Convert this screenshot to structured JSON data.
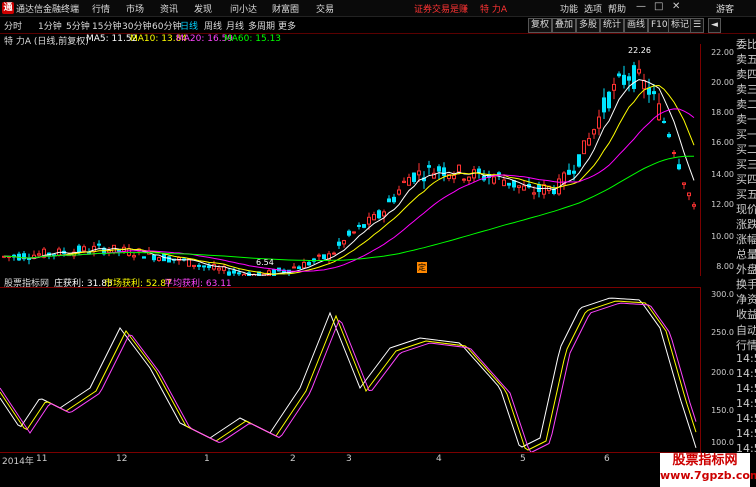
{
  "menubar": {
    "app_title": "通达信金融终端",
    "items": [
      "行情",
      "市场",
      "资讯",
      "发现",
      "问小达",
      "财富圈",
      "交易"
    ],
    "promo": "证券交易是赚",
    "stock": "特 力A",
    "right_items": [
      "功能",
      "选项",
      "帮助"
    ],
    "user": "游客"
  },
  "toolbar": {
    "periods": [
      "分时",
      "1分钟",
      "5分钟",
      "15分钟",
      "30分钟",
      "60分钟",
      "日线",
      "周线",
      "月线",
      "多周期",
      "更多"
    ],
    "selected": "日线",
    "buttons": [
      "复权",
      "叠加",
      "多股",
      "统计",
      "画线",
      "F10",
      "标记"
    ]
  },
  "main": {
    "stock_label": "特 力A (日线,前复权)",
    "ma5": "MA5: 11.52",
    "ma10": "MA10: 13.84",
    "ma20": "MA20: 16.59",
    "ma60": "MA60: 15.13",
    "high_label": "22.26",
    "low_label": "6.54",
    "marker": "定",
    "yticks": [
      "22.00",
      "20.00",
      "18.00",
      "16.00",
      "14.00",
      "12.00",
      "10.00",
      "8.00"
    ]
  },
  "indicator": {
    "name": "股票指标网",
    "v1": "庄获利: 31.83",
    "v2": "市场获利: 52.87",
    "v3": "平均获利: 63.11",
    "yticks": [
      "300.0",
      "250.0",
      "200.0",
      "150.0",
      "100.0"
    ]
  },
  "axis": {
    "labels": [
      "2014年",
      "11",
      "12",
      "1",
      "2",
      "3",
      "4",
      "5",
      "6"
    ]
  },
  "right_panel": {
    "labels": [
      "委比",
      "卖五",
      "卖四",
      "卖三",
      "卖二",
      "卖一",
      "买一",
      "买二",
      "买三",
      "买四",
      "买五",
      "现价",
      "涨跌",
      "涨幅",
      "总量",
      "外盘",
      "换手",
      "净资",
      "收益"
    ],
    "lower": [
      "自动",
      "行情",
      "14:5",
      "14:5",
      "14:5",
      "14:5",
      "14:5",
      "14:5",
      "14:5",
      "14:5",
      "14:5"
    ]
  },
  "watermark": {
    "line1": "股票指标网",
    "line2": "www.7gpzb.com"
  },
  "colors": {
    "up": "#ff3333",
    "down": "#00e5ff",
    "ma5": "#ffffff",
    "ma10": "#ffff00",
    "ma20": "#ff00ff",
    "ma60": "#00ff00"
  }
}
